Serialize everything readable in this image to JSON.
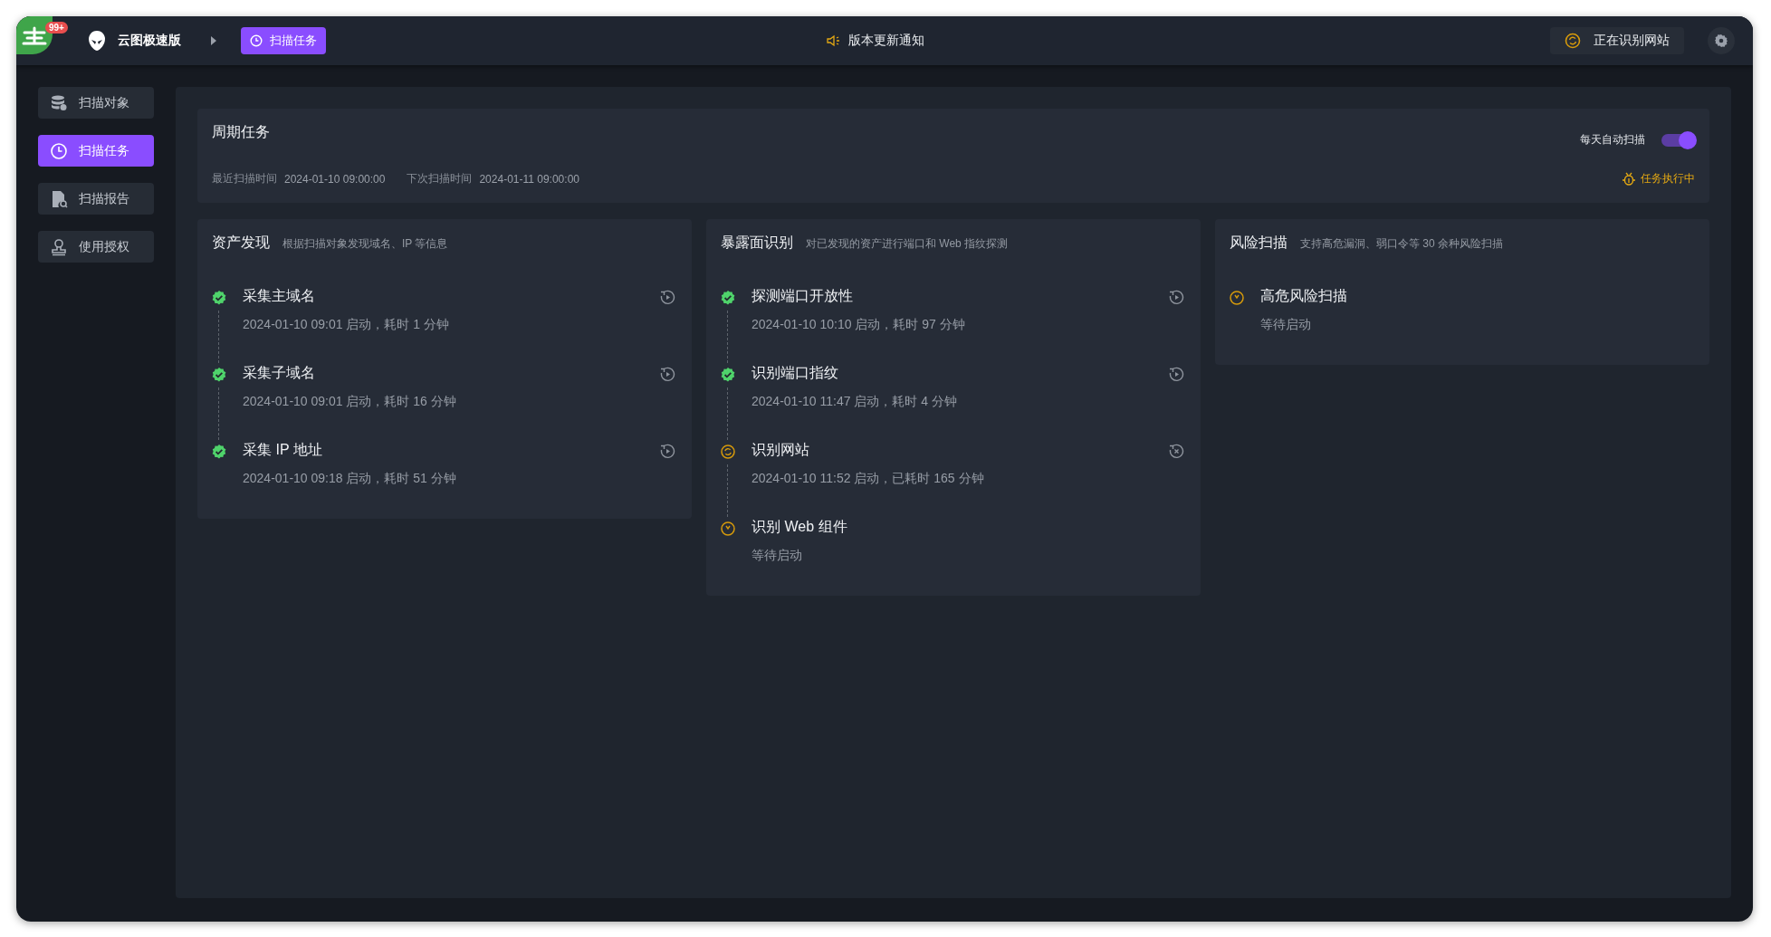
{
  "topbar": {
    "badge": "99+",
    "app_name": "云图极速版",
    "breadcrumb": "扫描任务",
    "notice": "版本更新通知",
    "status_pill": "正在识别网站"
  },
  "sidebar": {
    "items": [
      {
        "kind": "targets",
        "label": "扫描对象",
        "selected": false
      },
      {
        "kind": "tasks",
        "label": "扫描任务",
        "selected": true
      },
      {
        "kind": "reports",
        "label": "扫描报告",
        "selected": false
      },
      {
        "kind": "license",
        "label": "使用授权",
        "selected": false
      }
    ]
  },
  "periodic": {
    "title": "周期任务",
    "auto_scan": {
      "label": "每天自动扫描",
      "on": true
    },
    "last_scan": {
      "label": "最近扫描时间",
      "value": "2024-01-10 09:00:00"
    },
    "next_scan": {
      "label": "下次扫描时间",
      "value": "2024-01-11 09:00:00"
    },
    "status": "任务执行中"
  },
  "stages": [
    {
      "title": "资产发现",
      "description": "根据扫描对象发现域名、IP 等信息",
      "steps": [
        {
          "kind": "done",
          "name": "采集主域名",
          "detail": "2024-01-10 09:01 启动，耗时 1 分钟"
        },
        {
          "kind": "done",
          "name": "采集子域名",
          "detail": "2024-01-10 09:01 启动，耗时 16 分钟"
        },
        {
          "kind": "done",
          "name": "采集 IP 地址",
          "detail": "2024-01-10 09:18 启动，耗时 51 分钟"
        }
      ]
    },
    {
      "title": "暴露面识别",
      "description": "对已发现的资产进行端口和 Web 指纹探测",
      "steps": [
        {
          "kind": "done",
          "name": "探测端口开放性",
          "detail": "2024-01-10 10:10 启动，耗时 97 分钟"
        },
        {
          "kind": "done",
          "name": "识别端口指纹",
          "detail": "2024-01-10 11:47 启动，耗时 4 分钟"
        },
        {
          "kind": "running",
          "name": "识别网站",
          "detail": "2024-01-10 11:52 启动，已耗时 165 分钟"
        },
        {
          "kind": "waiting",
          "name": "识别 Web 组件",
          "detail": "等待启动"
        }
      ]
    },
    {
      "title": "风险扫描",
      "description": "支持高危漏洞、弱口令等 30 余种风险扫描",
      "steps": [
        {
          "kind": "waiting",
          "name": "高危风险扫描",
          "detail": "等待启动"
        }
      ]
    }
  ]
}
